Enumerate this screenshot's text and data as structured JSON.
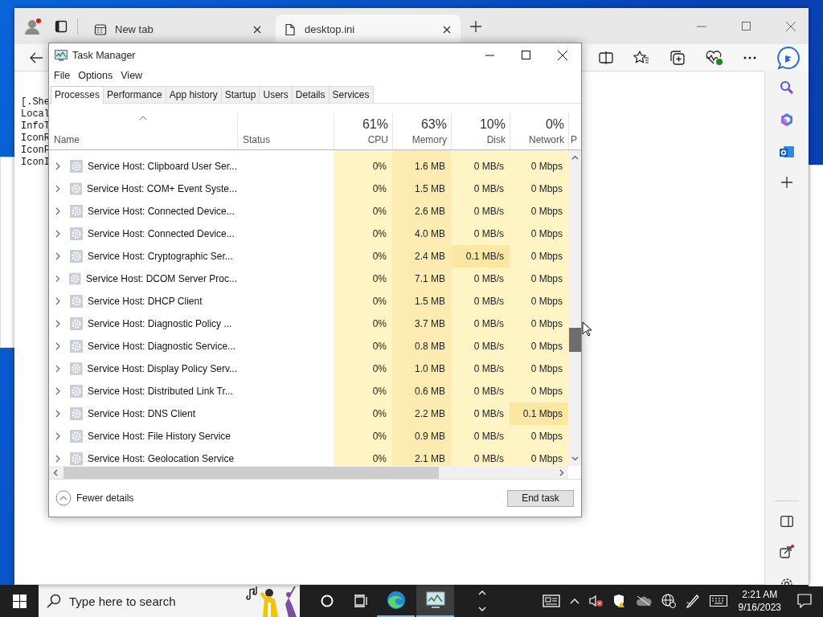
{
  "browser": {
    "tabs": [
      {
        "label": "New tab",
        "selected": false
      },
      {
        "label": "desktop.ini",
        "selected": true
      }
    ],
    "content_lines": [
      "[.She",
      "Local",
      "InfoT",
      "IconR",
      "IconF",
      "IconI"
    ]
  },
  "task_manager": {
    "title": "Task Manager",
    "menu": [
      "File",
      "Options",
      "View"
    ],
    "tabs": [
      {
        "label": "Processes",
        "selected": true
      },
      {
        "label": "Performance",
        "selected": false
      },
      {
        "label": "App history",
        "selected": false
      },
      {
        "label": "Startup",
        "selected": false
      },
      {
        "label": "Users",
        "selected": false
      },
      {
        "label": "Details",
        "selected": false
      },
      {
        "label": "Services",
        "selected": false
      }
    ],
    "columns": [
      {
        "label": "Name",
        "sorted": true
      },
      {
        "label": "Status",
        "sorted": false
      },
      {
        "percent": "61%",
        "label": "CPU",
        "sorted": false
      },
      {
        "percent": "63%",
        "label": "Memory",
        "sorted": false
      },
      {
        "percent": "10%",
        "label": "Disk",
        "sorted": false
      },
      {
        "percent": "0%",
        "label": "Network",
        "sorted": false
      },
      {
        "label": "P",
        "sorted": false
      }
    ],
    "rows": [
      {
        "name": "Service Host: Clipboard User Ser...",
        "cpu": "0%",
        "memory": "1.6 MB",
        "disk": "0 MB/s",
        "network": "0 Mbps",
        "disk_active": false,
        "network_active": false
      },
      {
        "name": "Service Host: COM+ Event Syste...",
        "cpu": "0%",
        "memory": "1.5 MB",
        "disk": "0 MB/s",
        "network": "0 Mbps",
        "disk_active": false,
        "network_active": false
      },
      {
        "name": "Service Host: Connected Device...",
        "cpu": "0%",
        "memory": "2.6 MB",
        "disk": "0 MB/s",
        "network": "0 Mbps",
        "disk_active": false,
        "network_active": false
      },
      {
        "name": "Service Host: Connected Device...",
        "cpu": "0%",
        "memory": "4.0 MB",
        "disk": "0 MB/s",
        "network": "0 Mbps",
        "disk_active": false,
        "network_active": false
      },
      {
        "name": "Service Host: Cryptographic Ser...",
        "cpu": "0%",
        "memory": "2.4 MB",
        "disk": "0.1 MB/s",
        "network": "0 Mbps",
        "disk_active": true,
        "network_active": false
      },
      {
        "name": "Service Host: DCOM Server Proc...",
        "cpu": "0%",
        "memory": "7.1 MB",
        "disk": "0 MB/s",
        "network": "0 Mbps",
        "disk_active": false,
        "network_active": false
      },
      {
        "name": "Service Host: DHCP Client",
        "cpu": "0%",
        "memory": "1.5 MB",
        "disk": "0 MB/s",
        "network": "0 Mbps",
        "disk_active": false,
        "network_active": false
      },
      {
        "name": "Service Host: Diagnostic Policy ...",
        "cpu": "0%",
        "memory": "3.7 MB",
        "disk": "0 MB/s",
        "network": "0 Mbps",
        "disk_active": false,
        "network_active": false
      },
      {
        "name": "Service Host: Diagnostic Service...",
        "cpu": "0%",
        "memory": "0.8 MB",
        "disk": "0 MB/s",
        "network": "0 Mbps",
        "disk_active": false,
        "network_active": false
      },
      {
        "name": "Service Host: Display Policy Serv...",
        "cpu": "0%",
        "memory": "1.0 MB",
        "disk": "0 MB/s",
        "network": "0 Mbps",
        "disk_active": false,
        "network_active": false
      },
      {
        "name": "Service Host: Distributed Link Tr...",
        "cpu": "0%",
        "memory": "0.6 MB",
        "disk": "0 MB/s",
        "network": "0 Mbps",
        "disk_active": false,
        "network_active": false
      },
      {
        "name": "Service Host: DNS Client",
        "cpu": "0%",
        "memory": "2.2 MB",
        "disk": "0 MB/s",
        "network": "0.1 Mbps",
        "disk_active": false,
        "network_active": true
      },
      {
        "name": "Service Host: File History Service",
        "cpu": "0%",
        "memory": "0.9 MB",
        "disk": "0 MB/s",
        "network": "0 Mbps",
        "disk_active": false,
        "network_active": false
      },
      {
        "name": "Service Host: Geolocation Service",
        "cpu": "0%",
        "memory": "2.1 MB",
        "disk": "0 MB/s",
        "network": "0 Mbps",
        "disk_active": false,
        "network_active": false
      }
    ],
    "fewer_details": "Fewer details",
    "end_task": "End task"
  },
  "taskbar": {
    "search_placeholder": "Type here to search",
    "apps": [
      {
        "kind": "edge",
        "active": false
      },
      {
        "kind": "task_manager",
        "active": true
      }
    ],
    "time": "2:21 AM",
    "date": "9/16/2023"
  }
}
